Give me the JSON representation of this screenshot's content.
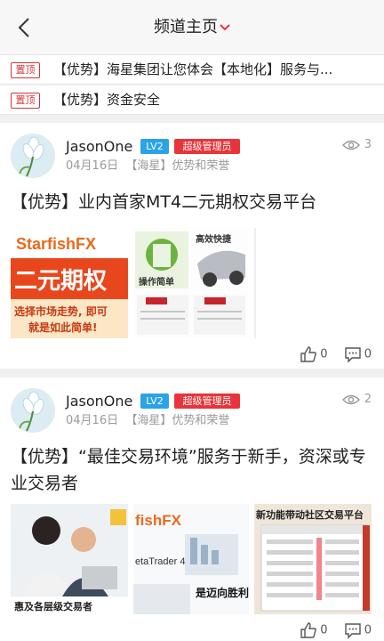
{
  "header": {
    "title": "频道主页"
  },
  "pinned": [
    {
      "tag": "置顶",
      "text": "【优势】海星集团让您体会【本地化】服务与..."
    },
    {
      "tag": "置顶",
      "text": "【优势】资金安全"
    }
  ],
  "posts": [
    {
      "author": "JasonOne",
      "level": "LV2",
      "role": "超级管理员",
      "date": "04月16日",
      "channel": "【海星】优势和荣誉",
      "views": "3",
      "title": "【优势】业内首家MT4二元期权交易平台",
      "likes": "0",
      "comments": "0",
      "images": [
        {
          "brand": "StarfishFX",
          "big": "二元期权",
          "caption1": "选择市场走势, 即可",
          "caption2": "就是如此简单!"
        },
        {
          "caption1": "操作简单",
          "caption2": "高效快捷"
        },
        {
          "caption1": ""
        }
      ]
    },
    {
      "author": "JasonOne",
      "level": "LV2",
      "role": "超级管理员",
      "date": "04月16日",
      "channel": "【海星】优势和荣誉",
      "views": "2",
      "title": "【优势】“最佳交易环境”服务于新手，资深或专业交易者",
      "likes": "0",
      "comments": "0",
      "images": [
        {
          "caption1": "惠及各层级交易者"
        },
        {
          "brand": "fishFX",
          "caption1": "etaTrader 4",
          "caption2": "是迈向胜利"
        },
        {
          "caption1": "新功能带动社区交易平台"
        }
      ]
    }
  ],
  "colors": {
    "accent_red": "#e8343a",
    "level_blue": "#2aa3e8",
    "meta_gray": "#9a9a9a"
  }
}
